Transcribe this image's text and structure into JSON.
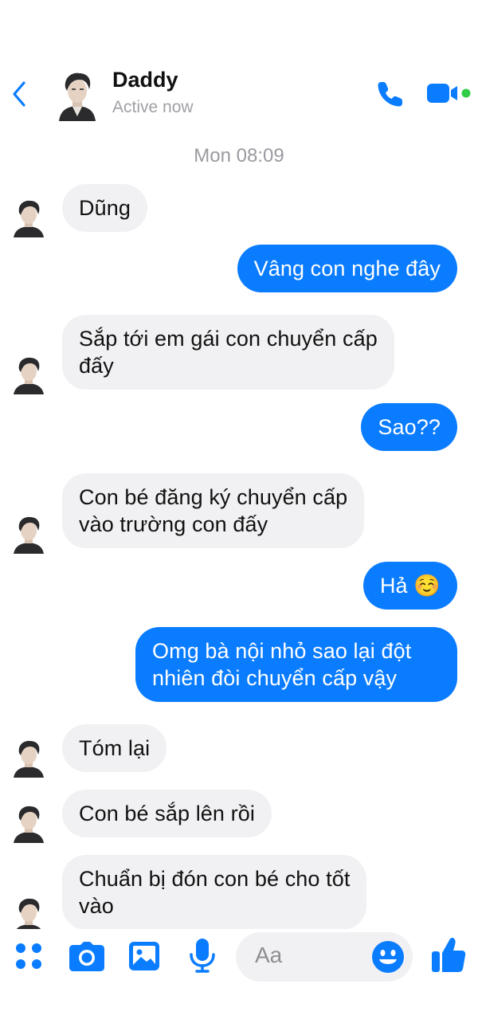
{
  "header": {
    "contact_name": "Daddy",
    "status": "Active now"
  },
  "timestamp": "Mon 08:09",
  "messages": [
    {
      "side": "in",
      "text": "Dũng"
    },
    {
      "side": "out",
      "text": "Vâng con nghe đây"
    },
    {
      "side": "in",
      "text": "Sắp tới em gái con chuyển cấp\nđấy"
    },
    {
      "side": "out",
      "text": "Sao??"
    },
    {
      "side": "in",
      "text": "Con bé đăng ký chuyển cấp\nvào trường con đấy"
    },
    {
      "side": "out",
      "text": "Hả ☺️"
    },
    {
      "side": "out",
      "text": "Omg bà nội nhỏ sao lại đột\nnhiên đòi chuyển cấp vậy"
    },
    {
      "side": "in",
      "text": "Tóm lại"
    },
    {
      "side": "in",
      "text": "Con bé sắp lên rồi"
    },
    {
      "side": "in",
      "text": "Chuẩn bị đón con bé cho tốt\nvào"
    }
  ],
  "composer": {
    "placeholder": "Aa"
  },
  "colors": {
    "accent": "#0a7cff",
    "incoming_bubble": "#f1f1f3",
    "online_dot": "#31cc46"
  },
  "icons": [
    "back-chevron",
    "phone",
    "video-camera",
    "menu-dots",
    "camera",
    "photo",
    "microphone",
    "emoji",
    "thumbs-up"
  ]
}
